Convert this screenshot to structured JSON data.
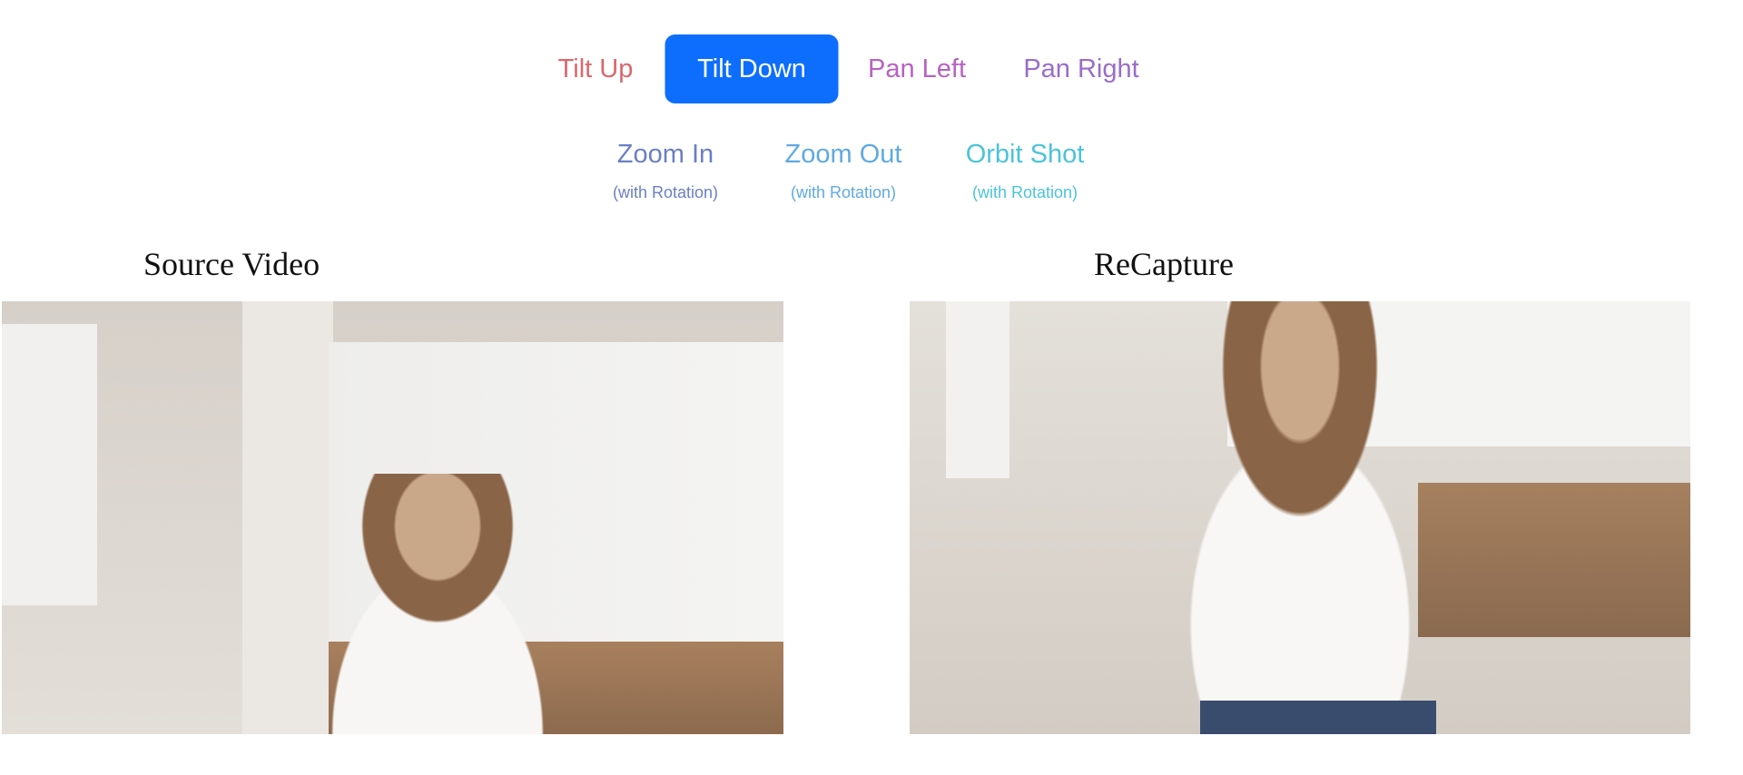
{
  "camera_controls": [
    {
      "label": "Tilt Up",
      "color": "#d9686e",
      "active": false
    },
    {
      "label": "Tilt Down",
      "color": "#ffffff",
      "active": true
    },
    {
      "label": "Pan Left",
      "color": "#b862c2",
      "active": false
    },
    {
      "label": "Pan Right",
      "color": "#9a6cc9",
      "active": false
    }
  ],
  "rotation_controls": [
    {
      "label": "Zoom In",
      "sub": "(with Rotation)",
      "color": "#6b7fc4"
    },
    {
      "label": "Zoom Out",
      "sub": "(with Rotation)",
      "color": "#5faae2"
    },
    {
      "label": "Orbit Shot",
      "sub": "(with Rotation)",
      "color": "#4cc3d9"
    }
  ],
  "accent": "#0d6efd",
  "videos": {
    "source_title": "Source Video",
    "result_title": "ReCapture"
  }
}
